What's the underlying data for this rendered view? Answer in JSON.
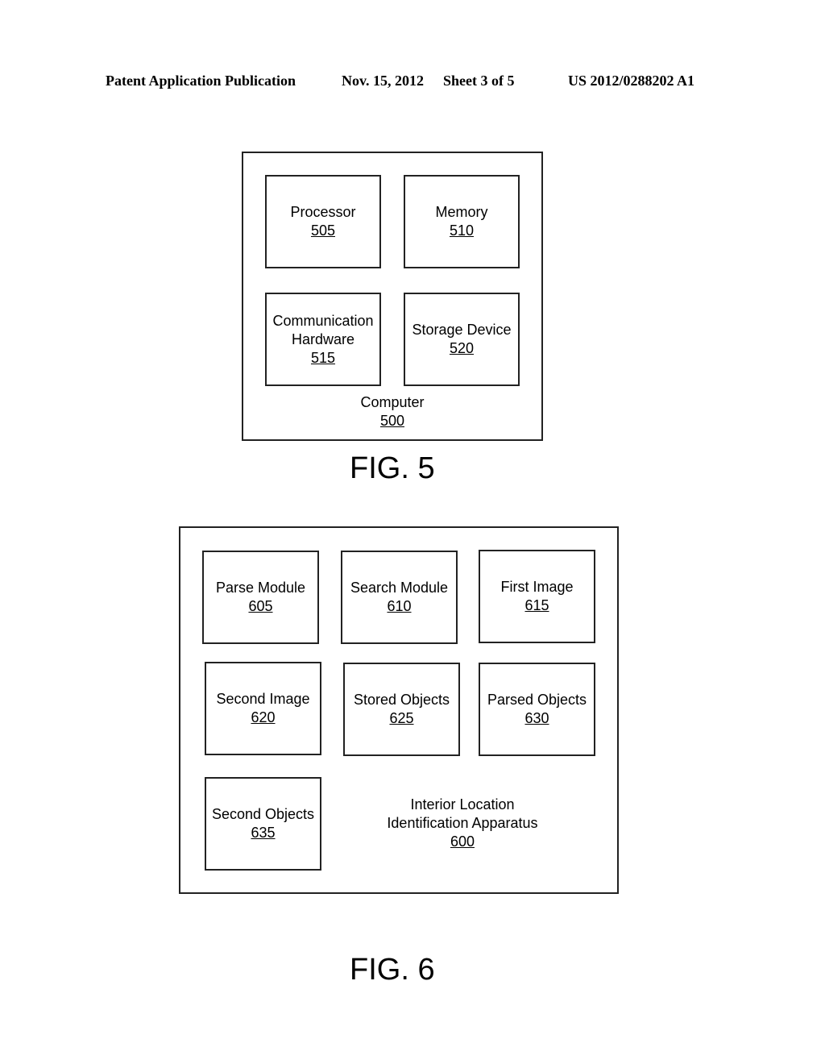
{
  "header": {
    "publication": "Patent Application Publication",
    "date": "Nov. 15, 2012",
    "sheet": "Sheet 3 of 5",
    "number": "US 2012/0288202 A1"
  },
  "fig5": {
    "label": "FIG. 5",
    "container": {
      "name": "Computer",
      "ref": "500"
    },
    "boxes": [
      {
        "lines": [
          "Processor"
        ],
        "ref": "505"
      },
      {
        "lines": [
          "Memory"
        ],
        "ref": "510"
      },
      {
        "lines": [
          "Communication",
          "Hardware"
        ],
        "ref": "515"
      },
      {
        "lines": [
          "Storage Device"
        ],
        "ref": "520"
      }
    ]
  },
  "fig6": {
    "label": "FIG. 6",
    "container": {
      "lines": [
        "Interior Location",
        "Identification Apparatus"
      ],
      "ref": "600"
    },
    "boxes": [
      {
        "lines": [
          "Parse Module"
        ],
        "ref": "605"
      },
      {
        "lines": [
          "Search Module"
        ],
        "ref": "610"
      },
      {
        "lines": [
          "First Image"
        ],
        "ref": "615"
      },
      {
        "lines": [
          "Second Image"
        ],
        "ref": "620"
      },
      {
        "lines": [
          "Stored Objects"
        ],
        "ref": "625"
      },
      {
        "lines": [
          "Parsed Objects"
        ],
        "ref": "630"
      },
      {
        "lines": [
          "Second Objects"
        ],
        "ref": "635"
      }
    ]
  }
}
